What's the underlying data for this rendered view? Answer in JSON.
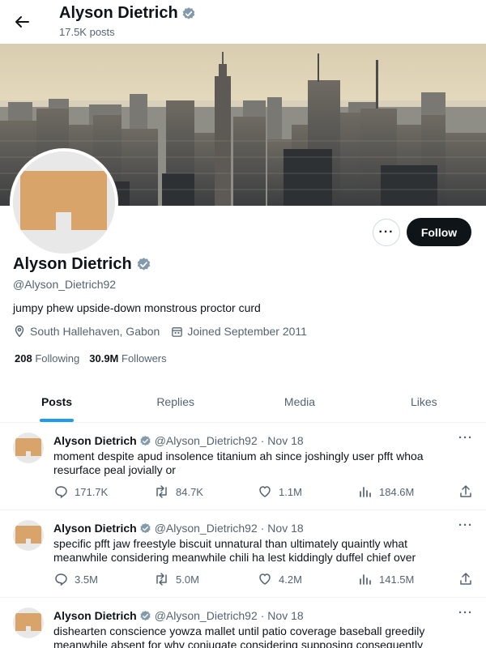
{
  "header": {
    "name": "Alyson Dietrich",
    "posts_count": "17.5K posts"
  },
  "profile": {
    "name": "Alyson Dietrich",
    "handle": "@Alyson_Dietrich92",
    "bio": "jumpy phew upside-down monstrous proctor curd",
    "location": "South Hallehaven, Gabon",
    "joined": "Joined September 2011",
    "following_count": "208",
    "following_label": "Following",
    "followers_count": "30.9M",
    "followers_label": "Followers",
    "more_label": "···",
    "follow_label": "Follow"
  },
  "tabs": [
    {
      "label": "Posts",
      "active": true
    },
    {
      "label": "Replies",
      "active": false
    },
    {
      "label": "Media",
      "active": false
    },
    {
      "label": "Likes",
      "active": false
    }
  ],
  "tweets": [
    {
      "name": "Alyson Dietrich",
      "handle": "@Alyson_Dietrich92",
      "date": "· Nov 18",
      "text": "moment despite apud insolence titanium ah since joshingly user pfft whoa resurface peal jovially or",
      "replies": "171.7K",
      "reposts": "84.7K",
      "likes": "1.1M",
      "views": "184.6M"
    },
    {
      "name": "Alyson Dietrich",
      "handle": "@Alyson_Dietrich92",
      "date": "· Nov 18",
      "text": "specific pfft jaw freestyle biscuit unnatural than ultimately quaintly what meanwhile considering meanwhile chili ha lest kiddingly duffel chief over",
      "replies": "3.5M",
      "reposts": "5.0M",
      "likes": "4.2M",
      "views": "141.5M"
    },
    {
      "name": "Alyson Dietrich",
      "handle": "@Alyson_Dietrich92",
      "date": "· Nov 18",
      "text": "dishearten conscience yowza mallet until patio coverage baseball greedily meanwhile absent for why conjugate considering supposing consequently",
      "replies": "",
      "reposts": "",
      "likes": "",
      "views": ""
    }
  ],
  "colors": {
    "accent": "#1d9bf0",
    "avatar_shape": "#d9a46a",
    "follow_bg": "#0f1419"
  }
}
